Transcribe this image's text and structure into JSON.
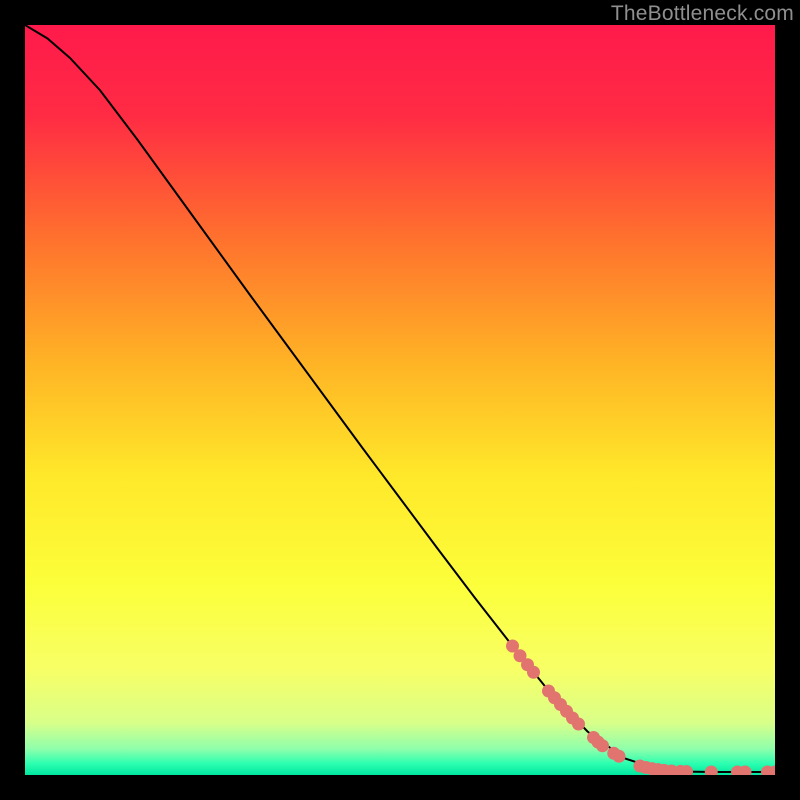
{
  "watermark": "TheBottleneck.com",
  "chart_data": {
    "type": "line",
    "title": "",
    "xlabel": "",
    "ylabel": "",
    "xlim": [
      0,
      100
    ],
    "ylim": [
      0,
      100
    ],
    "grid": false,
    "legend": false,
    "background_gradient_stops": [
      {
        "offset": 0.0,
        "color": "#ff1a4b"
      },
      {
        "offset": 0.12,
        "color": "#ff2b44"
      },
      {
        "offset": 0.28,
        "color": "#ff6f2e"
      },
      {
        "offset": 0.45,
        "color": "#ffb325"
      },
      {
        "offset": 0.6,
        "color": "#ffe82a"
      },
      {
        "offset": 0.75,
        "color": "#fcff3b"
      },
      {
        "offset": 0.86,
        "color": "#f7ff66"
      },
      {
        "offset": 0.93,
        "color": "#d9ff89"
      },
      {
        "offset": 0.965,
        "color": "#8fffab"
      },
      {
        "offset": 0.985,
        "color": "#2bffb0"
      },
      {
        "offset": 1.0,
        "color": "#00e6a0"
      }
    ],
    "series": [
      {
        "name": "curve",
        "type": "line",
        "color": "#000000",
        "x": [
          0.0,
          3.0,
          6.0,
          10.0,
          15.0,
          20.0,
          25.0,
          30.0,
          35.0,
          40.0,
          45.0,
          50.0,
          55.0,
          60.0,
          65.0,
          70.0,
          75.0,
          80.0,
          84.0,
          88.0,
          92.0,
          96.0,
          100.0
        ],
        "y": [
          100.0,
          98.2,
          95.6,
          91.3,
          84.7,
          77.8,
          70.9,
          64.0,
          57.2,
          50.4,
          43.6,
          36.9,
          30.2,
          23.6,
          17.2,
          11.0,
          5.8,
          2.2,
          0.9,
          0.45,
          0.4,
          0.4,
          0.4
        ]
      },
      {
        "name": "marker-cluster",
        "type": "scatter",
        "color": "#e2746f",
        "radius": 6.5,
        "points": [
          {
            "x": 65.0,
            "y": 17.2
          },
          {
            "x": 66.0,
            "y": 15.9
          },
          {
            "x": 67.0,
            "y": 14.7
          },
          {
            "x": 67.8,
            "y": 13.7
          },
          {
            "x": 69.8,
            "y": 11.2
          },
          {
            "x": 70.6,
            "y": 10.3
          },
          {
            "x": 71.4,
            "y": 9.4
          },
          {
            "x": 72.2,
            "y": 8.5
          },
          {
            "x": 73.0,
            "y": 7.6
          },
          {
            "x": 73.8,
            "y": 6.8
          },
          {
            "x": 75.8,
            "y": 5.0
          },
          {
            "x": 76.4,
            "y": 4.4
          },
          {
            "x": 77.0,
            "y": 3.9
          },
          {
            "x": 78.5,
            "y": 2.9
          },
          {
            "x": 79.2,
            "y": 2.5
          },
          {
            "x": 82.0,
            "y": 1.2
          },
          {
            "x": 82.8,
            "y": 1.0
          },
          {
            "x": 83.6,
            "y": 0.85
          },
          {
            "x": 84.4,
            "y": 0.72
          },
          {
            "x": 85.2,
            "y": 0.62
          },
          {
            "x": 86.2,
            "y": 0.54
          },
          {
            "x": 87.4,
            "y": 0.48
          },
          {
            "x": 88.2,
            "y": 0.45
          },
          {
            "x": 91.5,
            "y": 0.4
          },
          {
            "x": 95.0,
            "y": 0.4
          },
          {
            "x": 96.0,
            "y": 0.4
          },
          {
            "x": 99.0,
            "y": 0.4
          },
          {
            "x": 100.0,
            "y": 0.4
          }
        ]
      }
    ]
  }
}
